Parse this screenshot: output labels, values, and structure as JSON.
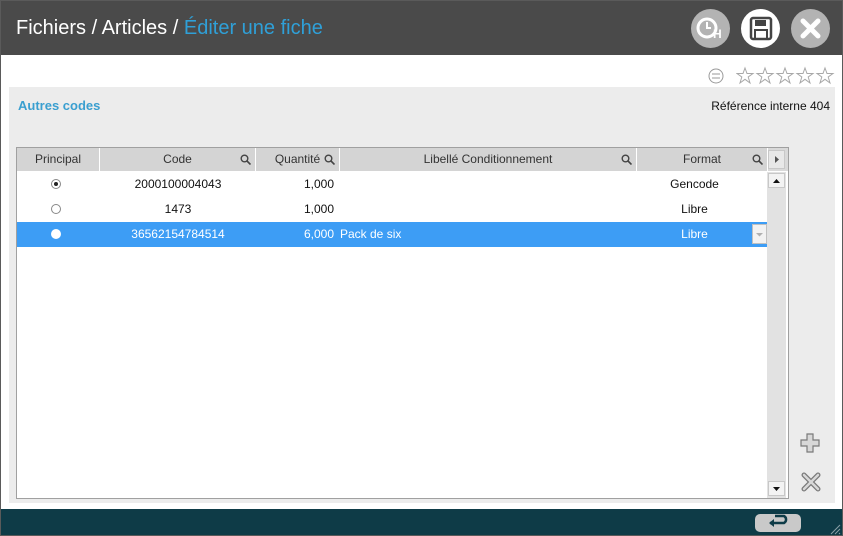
{
  "header": {
    "breadcrumb": [
      {
        "label": "Fichiers"
      },
      {
        "label": "Articles"
      },
      {
        "label": "Éditer une fiche"
      }
    ],
    "separator": "/",
    "buttons": {
      "history_icon": "clock-h-icon",
      "save_icon": "floppy-save-icon",
      "close_icon": "close-x-icon"
    }
  },
  "rating": {
    "neutral_icon": "neutral-face-icon",
    "stars_filled": 0,
    "stars_total": 5
  },
  "section": {
    "title": "Autres codes",
    "reference": "Référence interne 404"
  },
  "table": {
    "columns": {
      "principal": "Principal",
      "code": "Code",
      "quantite": "Quantité",
      "libelle": "Libellé Conditionnement",
      "format": "Format"
    },
    "rows": [
      {
        "principal": true,
        "code": "2000100004043",
        "quantite": "1,000",
        "libelle": "",
        "format": "Gencode"
      },
      {
        "principal": false,
        "code": "1473",
        "quantite": "1,000",
        "libelle": "",
        "format": "Libre"
      },
      {
        "principal": false,
        "code": "36562154784514",
        "quantite": "6,000",
        "libelle": "Pack de six",
        "format": "Libre"
      }
    ],
    "selected_row": 2
  },
  "side_actions": {
    "add_icon": "plus-icon",
    "delete_icon": "delete-x-icon"
  },
  "footer": {
    "back_icon": "return-arrow-icon"
  },
  "colors": {
    "header_bg": "#4a4a4a",
    "accent_blue": "#2fa0d8",
    "selection": "#3d9df5",
    "footer_bg": "#0e3b47"
  }
}
